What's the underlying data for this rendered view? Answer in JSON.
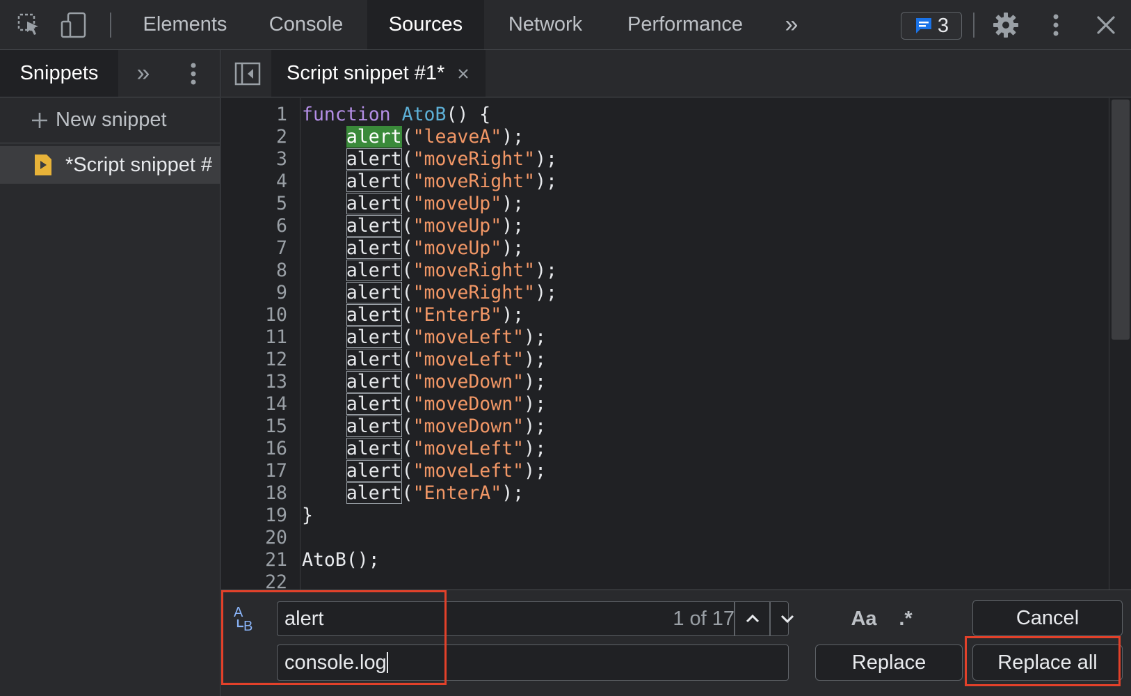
{
  "toolbar": {
    "tabs": [
      {
        "label": "Elements"
      },
      {
        "label": "Console"
      },
      {
        "label": "Sources"
      },
      {
        "label": "Network"
      },
      {
        "label": "Performance"
      }
    ],
    "active_tab": "Sources",
    "more_tabs_glyph": "»",
    "issues_count": "3",
    "icons": [
      "inspect-element-icon",
      "device-toolbar-icon",
      "more-tabs-icon",
      "issues-icon",
      "gear-icon",
      "kebab-menu-icon",
      "close-icon"
    ]
  },
  "left_panel": {
    "tab_label": "Snippets",
    "more_glyph": "»",
    "new_snippet_label": "New snippet",
    "snippet_item_label": "*Script snippet #"
  },
  "editor": {
    "tab_label": "Script snippet #1*",
    "lines": [
      {
        "n": "1",
        "tokens": [
          [
            "kw",
            "function"
          ],
          [
            "plain",
            " "
          ],
          [
            "fn",
            "AtoB"
          ],
          [
            "plain",
            "() {"
          ]
        ]
      },
      {
        "n": "2",
        "tokens": [
          [
            "plain",
            "    "
          ],
          [
            "hlcur",
            "alert"
          ],
          [
            "plain",
            "("
          ],
          [
            "str",
            "\"leaveA\""
          ],
          [
            "plain",
            ");"
          ]
        ]
      },
      {
        "n": "3",
        "tokens": [
          [
            "plain",
            "    "
          ],
          [
            "hl",
            "alert"
          ],
          [
            "plain",
            "("
          ],
          [
            "str",
            "\"moveRight\""
          ],
          [
            "plain",
            ");"
          ]
        ]
      },
      {
        "n": "4",
        "tokens": [
          [
            "plain",
            "    "
          ],
          [
            "hl",
            "alert"
          ],
          [
            "plain",
            "("
          ],
          [
            "str",
            "\"moveRight\""
          ],
          [
            "plain",
            ");"
          ]
        ]
      },
      {
        "n": "5",
        "tokens": [
          [
            "plain",
            "    "
          ],
          [
            "hl",
            "alert"
          ],
          [
            "plain",
            "("
          ],
          [
            "str",
            "\"moveUp\""
          ],
          [
            "plain",
            ");"
          ]
        ]
      },
      {
        "n": "6",
        "tokens": [
          [
            "plain",
            "    "
          ],
          [
            "hl",
            "alert"
          ],
          [
            "plain",
            "("
          ],
          [
            "str",
            "\"moveUp\""
          ],
          [
            "plain",
            ");"
          ]
        ]
      },
      {
        "n": "7",
        "tokens": [
          [
            "plain",
            "    "
          ],
          [
            "hl",
            "alert"
          ],
          [
            "plain",
            "("
          ],
          [
            "str",
            "\"moveUp\""
          ],
          [
            "plain",
            ");"
          ]
        ]
      },
      {
        "n": "8",
        "tokens": [
          [
            "plain",
            "    "
          ],
          [
            "hl",
            "alert"
          ],
          [
            "plain",
            "("
          ],
          [
            "str",
            "\"moveRight\""
          ],
          [
            "plain",
            ");"
          ]
        ]
      },
      {
        "n": "9",
        "tokens": [
          [
            "plain",
            "    "
          ],
          [
            "hl",
            "alert"
          ],
          [
            "plain",
            "("
          ],
          [
            "str",
            "\"moveRight\""
          ],
          [
            "plain",
            ");"
          ]
        ]
      },
      {
        "n": "10",
        "tokens": [
          [
            "plain",
            "    "
          ],
          [
            "hl",
            "alert"
          ],
          [
            "plain",
            "("
          ],
          [
            "str",
            "\"EnterB\""
          ],
          [
            "plain",
            ");"
          ]
        ]
      },
      {
        "n": "11",
        "tokens": [
          [
            "plain",
            "    "
          ],
          [
            "hl",
            "alert"
          ],
          [
            "plain",
            "("
          ],
          [
            "str",
            "\"moveLeft\""
          ],
          [
            "plain",
            ");"
          ]
        ]
      },
      {
        "n": "12",
        "tokens": [
          [
            "plain",
            "    "
          ],
          [
            "hl",
            "alert"
          ],
          [
            "plain",
            "("
          ],
          [
            "str",
            "\"moveLeft\""
          ],
          [
            "plain",
            ");"
          ]
        ]
      },
      {
        "n": "13",
        "tokens": [
          [
            "plain",
            "    "
          ],
          [
            "hl",
            "alert"
          ],
          [
            "plain",
            "("
          ],
          [
            "str",
            "\"moveDown\""
          ],
          [
            "plain",
            ");"
          ]
        ]
      },
      {
        "n": "14",
        "tokens": [
          [
            "plain",
            "    "
          ],
          [
            "hl",
            "alert"
          ],
          [
            "plain",
            "("
          ],
          [
            "str",
            "\"moveDown\""
          ],
          [
            "plain",
            ");"
          ]
        ]
      },
      {
        "n": "15",
        "tokens": [
          [
            "plain",
            "    "
          ],
          [
            "hl",
            "alert"
          ],
          [
            "plain",
            "("
          ],
          [
            "str",
            "\"moveDown\""
          ],
          [
            "plain",
            ");"
          ]
        ]
      },
      {
        "n": "16",
        "tokens": [
          [
            "plain",
            "    "
          ],
          [
            "hl",
            "alert"
          ],
          [
            "plain",
            "("
          ],
          [
            "str",
            "\"moveLeft\""
          ],
          [
            "plain",
            ");"
          ]
        ]
      },
      {
        "n": "17",
        "tokens": [
          [
            "plain",
            "    "
          ],
          [
            "hl",
            "alert"
          ],
          [
            "plain",
            "("
          ],
          [
            "str",
            "\"moveLeft\""
          ],
          [
            "plain",
            ");"
          ]
        ]
      },
      {
        "n": "18",
        "tokens": [
          [
            "plain",
            "    "
          ],
          [
            "hl",
            "alert"
          ],
          [
            "plain",
            "("
          ],
          [
            "str",
            "\"EnterA\""
          ],
          [
            "plain",
            ");"
          ]
        ]
      },
      {
        "n": "19",
        "tokens": [
          [
            "plain",
            "}"
          ]
        ]
      },
      {
        "n": "20",
        "tokens": []
      },
      {
        "n": "21",
        "tokens": [
          [
            "plain",
            "AtoB();"
          ]
        ]
      },
      {
        "n": "22",
        "tokens": []
      }
    ]
  },
  "find_replace": {
    "find_value": "alert",
    "match_count": "1 of 17",
    "replace_value": "console.log",
    "case_toggle_label": "Aa",
    "regex_toggle_label": ".*",
    "cancel_label": "Cancel",
    "replace_label": "Replace",
    "replace_all_label": "Replace all"
  },
  "colors": {
    "accent_highlight": "#e2412a",
    "current_match": "#3a8a3a",
    "issues_icon": "#1a73e8",
    "snippet_icon": "#e8b339"
  }
}
